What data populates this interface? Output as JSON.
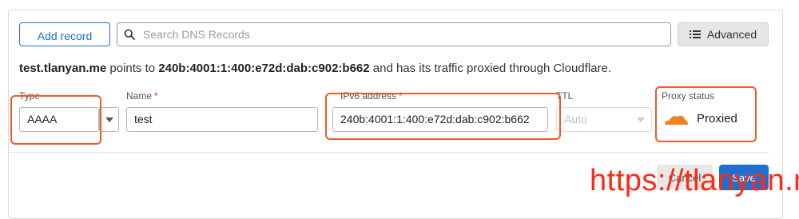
{
  "toolbar": {
    "add_record_label": "Add record",
    "search_placeholder": "Search DNS Records",
    "advanced_label": "Advanced"
  },
  "info": {
    "hostname": "test.tlanyan.me",
    "points_to": "points to",
    "address": "240b:4001:1:400:e72d:dab:c902:b662",
    "suffix": "and has its traffic proxied through Cloudflare."
  },
  "form": {
    "type": {
      "label": "Type",
      "value": "AAAA"
    },
    "name": {
      "label": "Name",
      "required_mark": "*",
      "value": "test"
    },
    "ipv6": {
      "label": "IPv6 address",
      "required_mark": "*",
      "value": "240b:4001:1:400:e72d:dab:c902:b662"
    },
    "ttl": {
      "label": "TTL",
      "value": "Auto"
    },
    "proxy": {
      "label": "Proxy status",
      "value": "Proxied"
    }
  },
  "actions": {
    "cancel_label": "Cancel",
    "save_label": "Save"
  },
  "watermark": "https://tlanyan.me",
  "colors": {
    "accent": "#1f6fcf",
    "highlight": "#f05a28",
    "cloud": "#f38020",
    "watermark": "#ff2a14"
  }
}
